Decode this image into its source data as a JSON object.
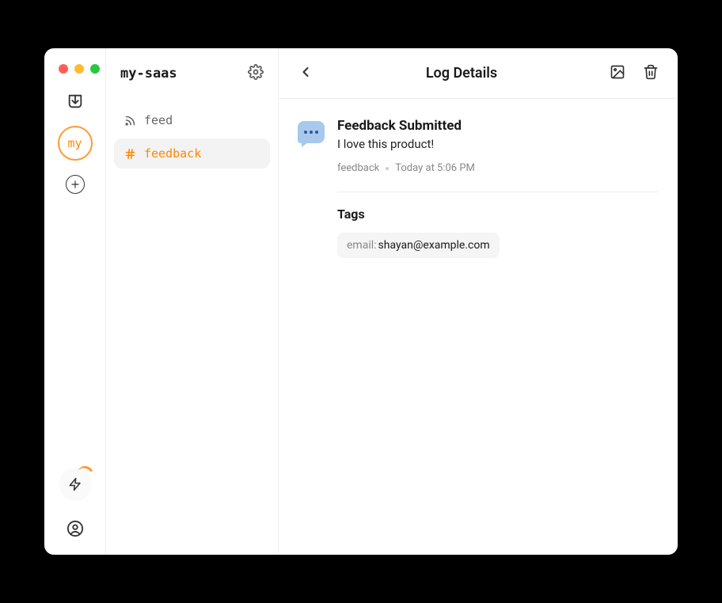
{
  "project": {
    "name": "my-saas",
    "badge": "my"
  },
  "channels": [
    {
      "id": "feed",
      "label": "feed",
      "icon": "rss",
      "active": false
    },
    {
      "id": "feedback",
      "label": "feedback",
      "icon": "hash",
      "active": true
    }
  ],
  "main": {
    "title": "Log Details"
  },
  "log": {
    "title": "Feedback Submitted",
    "message": "I love this product!",
    "channel": "feedback",
    "timestamp": "Today at 5:06 PM"
  },
  "tags": {
    "heading": "Tags",
    "items": [
      {
        "key": "email",
        "value": "shayan@example.com"
      }
    ]
  }
}
